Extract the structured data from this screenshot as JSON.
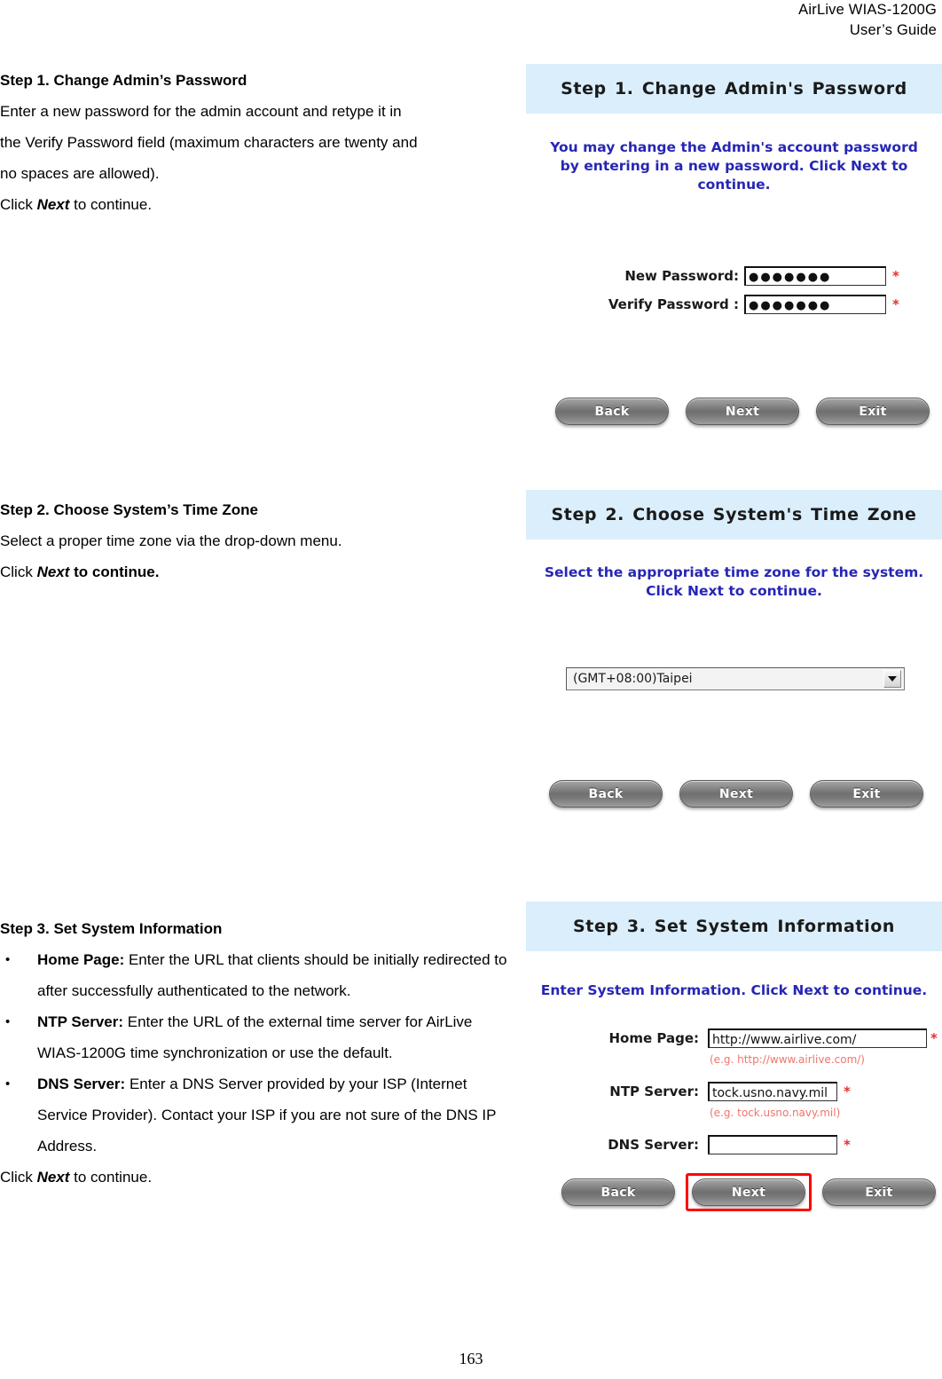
{
  "header": {
    "line1": "AirLive  WIAS-1200G",
    "line2": "User’s  Guide"
  },
  "page_number": "163",
  "sections": [
    {
      "title": "Step 1. Change Admin’s Password",
      "body_line1": "Enter a new password for the admin account and retype it in",
      "body_line2": "the Verify Password field (maximum characters are twenty and",
      "body_line3": "no spaces are allowed).",
      "click_prefix": "Click ",
      "click_emphasis": "Next",
      "click_suffix": " to continue."
    },
    {
      "title": "Step 2. Choose System’s Time Zone",
      "body_line1": "Select a proper time zone via the drop-down menu.",
      "click_prefix": "Click ",
      "click_emphasis": "Next",
      "click_suffix": " to continue."
    },
    {
      "title": "Step 3. Set System Information",
      "bullets": [
        {
          "lead": "Home Page:",
          "text": " Enter the URL that clients should be initially redirected to after successfully authenticated to the network."
        },
        {
          "lead": "NTP Server:",
          "text": " Enter the URL of the external time server for AirLive WIAS-1200G time synchronization or use the default."
        },
        {
          "lead": "DNS Server:",
          "text": " Enter a DNS Server provided by your ISP (Internet Service Provider). Contact your ISP if you are not sure of the DNS IP Address."
        }
      ],
      "click_prefix": "Click ",
      "click_emphasis": "Next",
      "click_suffix": " to continue."
    }
  ],
  "panels": [
    {
      "id": "step1",
      "title": "Step 1. Change Admin's Password",
      "instruction": "You may change the Admin's account password by entering in a new password. Click Next to continue.",
      "fields": [
        {
          "label": "New Password:",
          "value": "●●●●●●●",
          "required_mark": "*"
        },
        {
          "label": "Verify Password :",
          "value": "●●●●●●●",
          "required_mark": "*"
        }
      ],
      "buttons": [
        {
          "label": "Back",
          "highlighted": false
        },
        {
          "label": "Next",
          "highlighted": false
        },
        {
          "label": "Exit",
          "highlighted": false
        }
      ]
    },
    {
      "id": "step2",
      "title": "Step 2. Choose System's Time Zone",
      "instruction": "Select the appropriate time zone for the system. Click Next to continue.",
      "timezone": {
        "selected": "(GMT+08:00)Taipei"
      },
      "buttons": [
        {
          "label": "Back",
          "highlighted": false
        },
        {
          "label": "Next",
          "highlighted": false
        },
        {
          "label": "Exit",
          "highlighted": false
        }
      ]
    },
    {
      "id": "step3",
      "title": "Step 3. Set System Information",
      "instruction": "Enter System Information. Click Next to continue.",
      "fields": [
        {
          "label": "Home Page:",
          "value": "http://www.airlive.com/",
          "required_mark": "*",
          "hint": "(e.g. http://www.airlive.com/)"
        },
        {
          "label": "NTP Server:",
          "value": "tock.usno.navy.mil",
          "required_mark": "*",
          "hint": "(e.g. tock.usno.navy.mil)"
        },
        {
          "label": "DNS Server:",
          "value": "",
          "required_mark": "*",
          "hint": ""
        }
      ],
      "buttons": [
        {
          "label": "Back",
          "highlighted": false
        },
        {
          "label": "Next",
          "highlighted": true
        },
        {
          "label": "Exit",
          "highlighted": false
        }
      ]
    }
  ],
  "colors": {
    "panel_title_bg": "#daeefb",
    "instruction_text": "#2626b5",
    "hint_text": "#f0756b",
    "required_star": "#e2312f",
    "highlight_box": "#ff0000"
  }
}
